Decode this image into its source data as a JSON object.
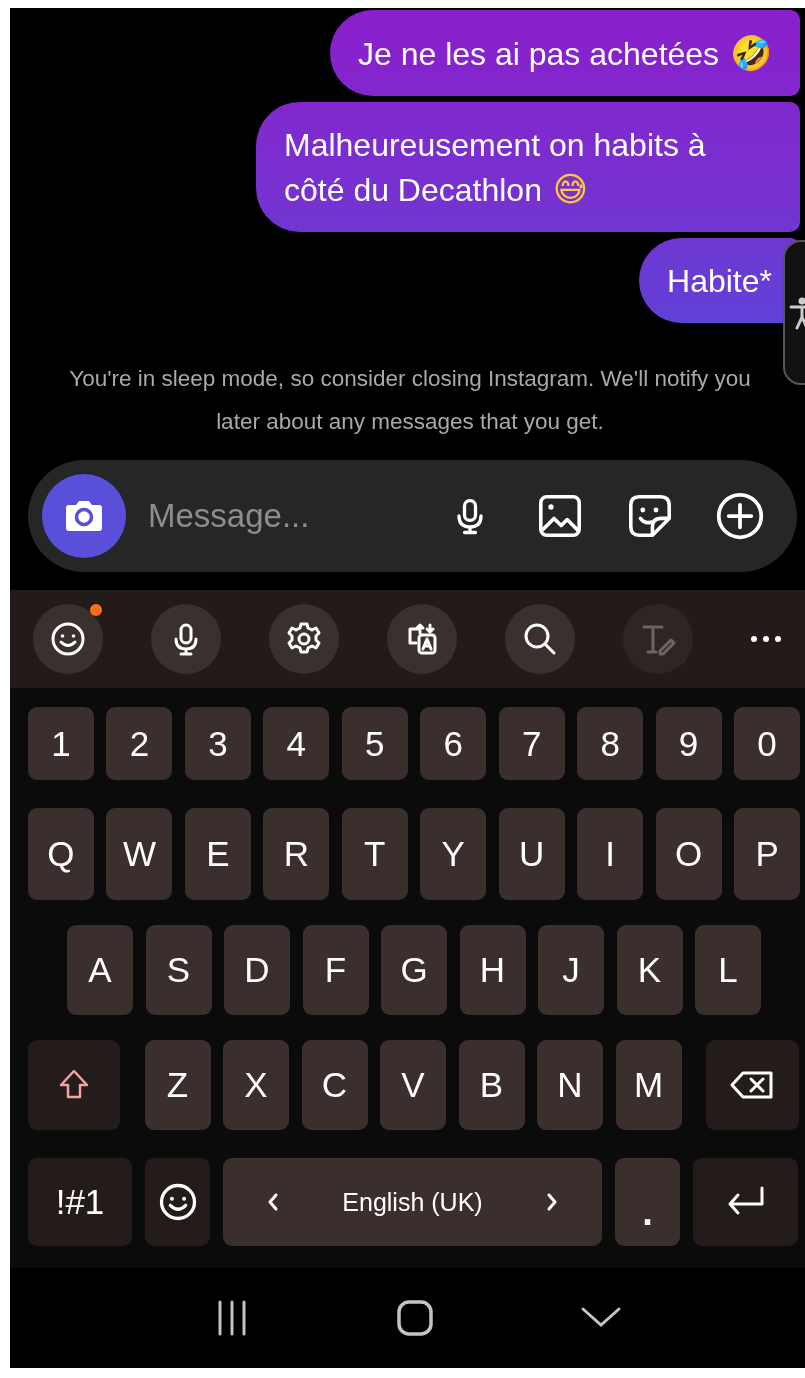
{
  "messages": [
    {
      "text": "Je ne les ai pas achetées",
      "emoji": "🤣"
    },
    {
      "text": "Malheureusement on habits à côté du Decathlon",
      "emoji": "😅"
    },
    {
      "text": "Habite*"
    }
  ],
  "notice": "You're in sleep mode, so consider closing Instagram. We'll notify you later about any messages that you get.",
  "composer": {
    "placeholder": "Message..."
  },
  "keyboard": {
    "toolbar": [
      {
        "kind": "emoji",
        "badge": true,
        "disabled": false
      },
      {
        "kind": "voice",
        "badge": false,
        "disabled": false
      },
      {
        "kind": "settings",
        "badge": false,
        "disabled": false
      },
      {
        "kind": "translate",
        "badge": false,
        "disabled": false
      },
      {
        "kind": "search",
        "badge": false,
        "disabled": false
      },
      {
        "kind": "handwriting",
        "badge": false,
        "disabled": true
      },
      {
        "kind": "more",
        "badge": false,
        "disabled": false
      }
    ],
    "rows": [
      {
        "keys": [
          {
            "kind": "char",
            "label": "1"
          },
          {
            "kind": "char",
            "label": "2"
          },
          {
            "kind": "char",
            "label": "3"
          },
          {
            "kind": "char",
            "label": "4"
          },
          {
            "kind": "char",
            "label": "5"
          },
          {
            "kind": "char",
            "label": "6"
          },
          {
            "kind": "char",
            "label": "7"
          },
          {
            "kind": "char",
            "label": "8"
          },
          {
            "kind": "char",
            "label": "9"
          },
          {
            "kind": "char",
            "label": "0"
          }
        ]
      },
      {
        "keys": [
          {
            "kind": "char",
            "label": "Q"
          },
          {
            "kind": "char",
            "label": "W"
          },
          {
            "kind": "char",
            "label": "E"
          },
          {
            "kind": "char",
            "label": "R"
          },
          {
            "kind": "char",
            "label": "T"
          },
          {
            "kind": "char",
            "label": "Y"
          },
          {
            "kind": "char",
            "label": "U"
          },
          {
            "kind": "char",
            "label": "I"
          },
          {
            "kind": "char",
            "label": "O"
          },
          {
            "kind": "char",
            "label": "P"
          }
        ]
      },
      {
        "keys": [
          {
            "kind": "char",
            "label": "A"
          },
          {
            "kind": "char",
            "label": "S"
          },
          {
            "kind": "char",
            "label": "D"
          },
          {
            "kind": "char",
            "label": "F"
          },
          {
            "kind": "char",
            "label": "G"
          },
          {
            "kind": "char",
            "label": "H"
          },
          {
            "kind": "char",
            "label": "J"
          },
          {
            "kind": "char",
            "label": "K"
          },
          {
            "kind": "char",
            "label": "L"
          }
        ]
      },
      {
        "keys": [
          {
            "kind": "shift"
          },
          {
            "kind": "char",
            "label": "Z"
          },
          {
            "kind": "char",
            "label": "X"
          },
          {
            "kind": "char",
            "label": "C"
          },
          {
            "kind": "char",
            "label": "V"
          },
          {
            "kind": "char",
            "label": "B"
          },
          {
            "kind": "char",
            "label": "N"
          },
          {
            "kind": "char",
            "label": "M"
          },
          {
            "kind": "backspace"
          }
        ]
      },
      {
        "keys": [
          {
            "kind": "symbols",
            "label": "!#1"
          },
          {
            "kind": "emoji"
          },
          {
            "kind": "space",
            "label": "English (UK)"
          },
          {
            "kind": "period",
            "label": "."
          },
          {
            "kind": "enter"
          }
        ]
      }
    ]
  }
}
